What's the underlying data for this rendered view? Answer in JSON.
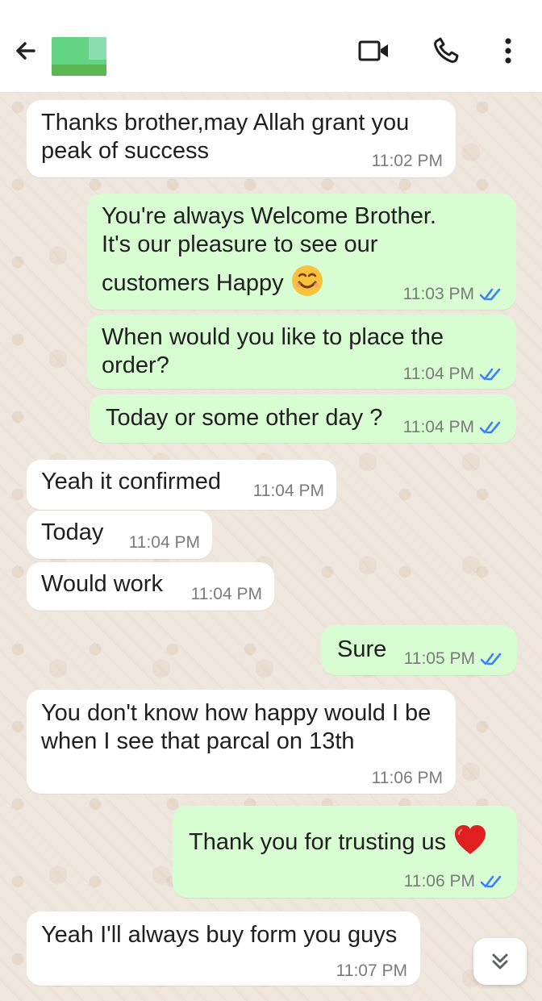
{
  "header": {
    "back_icon": "back-arrow-icon",
    "avatar": "contact-avatar-obscured",
    "video_icon": "video-call-icon",
    "call_icon": "voice-call-icon",
    "menu_icon": "more-options-icon"
  },
  "messages": [
    {
      "direction": "incoming",
      "lines": [
        "Thanks brother,may Allah grant you",
        "peak of success"
      ],
      "time": "11:02 PM"
    },
    {
      "direction": "outgoing",
      "lines": [
        "You're always Welcome Brother.",
        "It's our pleasure to see our",
        "customers Happy"
      ],
      "emoji": "smiling-face-emoji",
      "time": "11:03 PM",
      "status": "read"
    },
    {
      "direction": "outgoing",
      "lines": [
        "When would you like to place the",
        "order?"
      ],
      "time": "11:04 PM",
      "status": "read"
    },
    {
      "direction": "outgoing",
      "lines": [
        "Today or some other day ?"
      ],
      "time": "11:04 PM",
      "status": "read"
    },
    {
      "direction": "incoming",
      "lines": [
        "Yeah it confirmed"
      ],
      "time": "11:04 PM"
    },
    {
      "direction": "incoming",
      "lines": [
        "Today"
      ],
      "time": "11:04 PM"
    },
    {
      "direction": "incoming",
      "lines": [
        "Would work"
      ],
      "time": "11:04 PM"
    },
    {
      "direction": "outgoing",
      "lines": [
        "Sure"
      ],
      "time": "11:05 PM",
      "status": "read"
    },
    {
      "direction": "incoming",
      "lines": [
        "You don't know how happy would I be",
        "when I see that parcal on 13th"
      ],
      "time": "11:06 PM"
    },
    {
      "direction": "outgoing",
      "lines": [
        "Thank you for trusting us"
      ],
      "emoji": "red-heart-emoji",
      "time": "11:06 PM",
      "status": "read"
    },
    {
      "direction": "incoming",
      "lines": [
        "Yeah I'll always buy form you guys"
      ],
      "time": "11:07 PM"
    }
  ],
  "scroll_button_icon": "double-chevron-down-icon",
  "colors": {
    "header_bg": "#ffffff",
    "chat_bg": "#efe7de",
    "incoming_bubble": "#ffffff",
    "outgoing_bubble": "#d9fdd3",
    "read_ticks": "#3b82f6",
    "heart": "#e02020"
  }
}
